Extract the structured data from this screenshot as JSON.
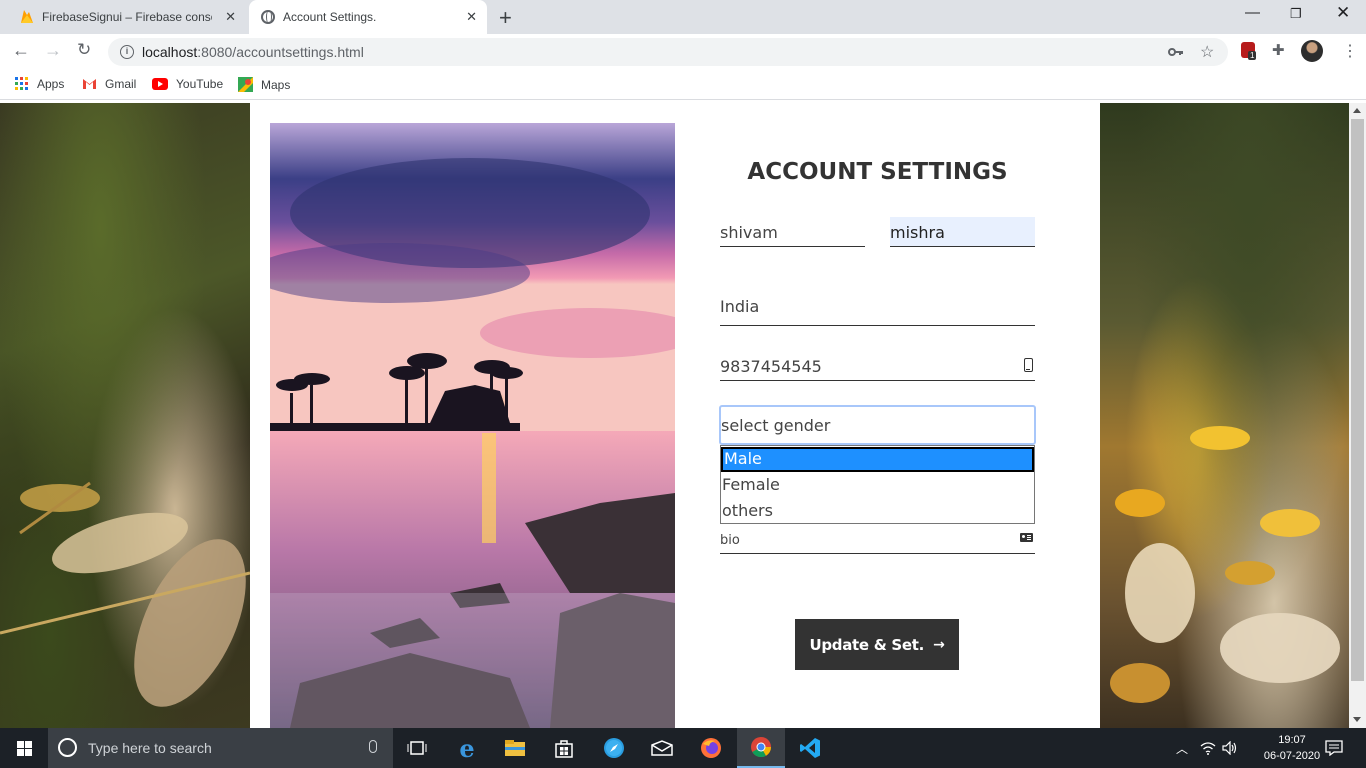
{
  "browser": {
    "tabs": [
      {
        "title": "FirebaseSignui – Firebase console",
        "active": false
      },
      {
        "title": "Account Settings.",
        "active": true
      }
    ],
    "url_host": "localhost",
    "url_rest": ":8080/accountsettings.html",
    "bookmarks": [
      "Apps",
      "Gmail",
      "YouTube",
      "Maps"
    ],
    "extension_badge": "1"
  },
  "form": {
    "title": "ACCOUNT SETTINGS",
    "first_name": "shivam",
    "last_name": "mishra",
    "country": "India",
    "phone": "9837454545",
    "gender_placeholder": "select gender",
    "gender_options": [
      "Male",
      "Female",
      "others"
    ],
    "gender_highlighted": "Male",
    "bio_placeholder": "bio",
    "submit_label": "Update & Set.",
    "submit_arrow": "→"
  },
  "taskbar": {
    "search_placeholder": "Type here to search",
    "time": "19:07",
    "date": "06-07-2020"
  },
  "colors": {
    "button_bg": "#333333",
    "option_highlight": "#1e90ff",
    "autofill_bg": "#e8f0fe",
    "taskbar_bg": "#1c2127"
  }
}
